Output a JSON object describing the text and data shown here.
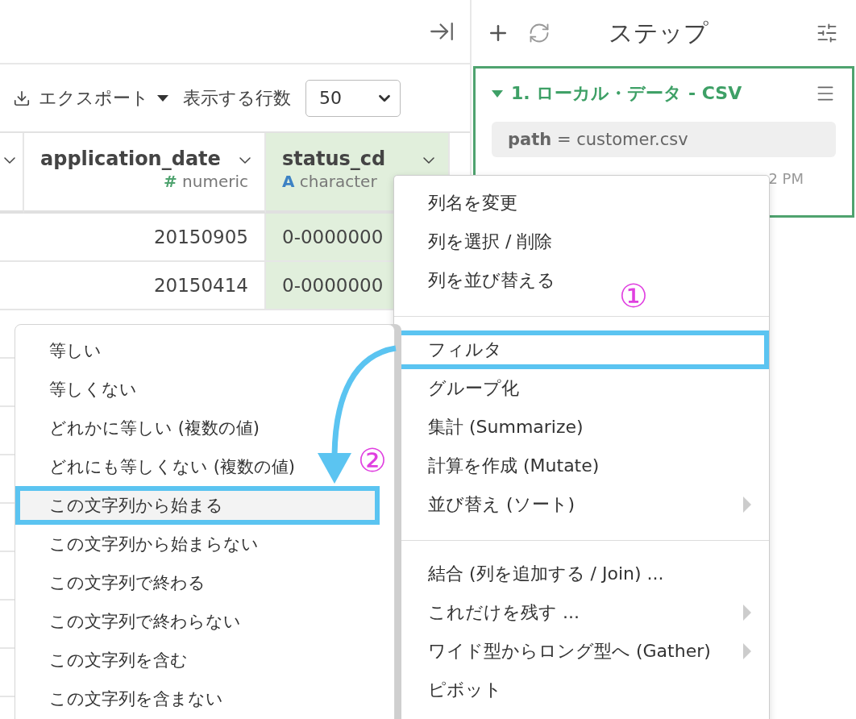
{
  "toolbar": {
    "export_label": "エクスポート",
    "rows_label": "表示する行数",
    "rows_value": "50"
  },
  "table": {
    "columns": [
      {
        "highlighted": false
      },
      {
        "name": "application_date",
        "type_icon": "#",
        "type": "numeric",
        "highlighted": false
      },
      {
        "name": "status_cd",
        "type_icon": "A",
        "type": "character",
        "highlighted": true
      }
    ],
    "rows": [
      [
        "",
        "20150905",
        "0-0000000"
      ],
      [
        "",
        "20150414",
        "0-0000000"
      ]
    ]
  },
  "steps_panel": {
    "title": "ステップ",
    "step": {
      "title": "1. ローカル・データ - CSV",
      "param_key": "path",
      "param_value": "= customer.csv",
      "time": "2 PM"
    }
  },
  "column_menu": [
    {
      "kind": "item",
      "label": "列名を変更",
      "submenu": false,
      "outlined": false
    },
    {
      "kind": "item",
      "label": "列を選択 / 削除",
      "submenu": false,
      "outlined": false
    },
    {
      "kind": "item",
      "label": "列を並び替える",
      "submenu": false,
      "outlined": false
    },
    {
      "kind": "divider"
    },
    {
      "kind": "item",
      "label": "フィルタ",
      "submenu": false,
      "outlined": true
    },
    {
      "kind": "item",
      "label": "グループ化",
      "submenu": false,
      "outlined": false
    },
    {
      "kind": "item",
      "label": "集計 (Summarize)",
      "submenu": false,
      "outlined": false
    },
    {
      "kind": "item",
      "label": "計算を作成 (Mutate)",
      "submenu": false,
      "outlined": false
    },
    {
      "kind": "item",
      "label": "並び替え (ソート)",
      "submenu": true,
      "outlined": false
    },
    {
      "kind": "divider"
    },
    {
      "kind": "item",
      "label": "結合 (列を追加する / Join) ...",
      "submenu": false,
      "outlined": false
    },
    {
      "kind": "item",
      "label": "これだけを残す ...",
      "submenu": true,
      "outlined": false
    },
    {
      "kind": "item",
      "label": "ワイド型からロング型へ (Gather)",
      "submenu": true,
      "outlined": false
    },
    {
      "kind": "item",
      "label": "ピボット",
      "submenu": false,
      "outlined": false
    }
  ],
  "filter_submenu": [
    {
      "label": "等しい",
      "selected": false,
      "outlined": false
    },
    {
      "label": "等しくない",
      "selected": false,
      "outlined": false
    },
    {
      "label": "どれかに等しい (複数の値)",
      "selected": false,
      "outlined": false
    },
    {
      "label": "どれにも等しくない (複数の値)",
      "selected": false,
      "outlined": false
    },
    {
      "label": "この文字列から始まる",
      "selected": true,
      "outlined": true
    },
    {
      "label": "この文字列から始まらない",
      "selected": false,
      "outlined": false
    },
    {
      "label": "この文字列で終わる",
      "selected": false,
      "outlined": false
    },
    {
      "label": "この文字列で終わらない",
      "selected": false,
      "outlined": false
    },
    {
      "label": "この文字列を含む",
      "selected": false,
      "outlined": false
    },
    {
      "label": "この文字列を含まない",
      "selected": false,
      "outlined": false
    }
  ],
  "annotations": [
    {
      "label": "①"
    },
    {
      "label": "②"
    }
  ]
}
